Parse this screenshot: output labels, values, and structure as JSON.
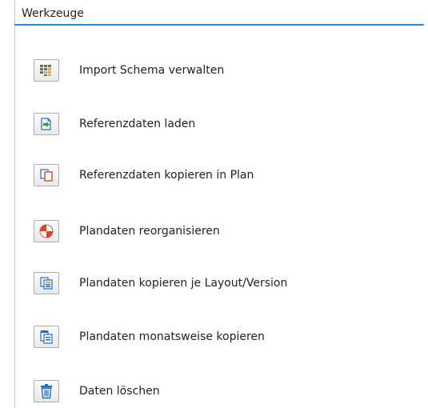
{
  "panel": {
    "title": "Werkzeuge"
  },
  "tools": [
    {
      "label": "Import Schema verwalten",
      "icon": "import-schema-icon"
    },
    {
      "label": "Referenzdaten laden",
      "icon": "load-reference-icon"
    },
    {
      "label": "Referenzdaten kopieren in Plan",
      "icon": "copy-reference-icon"
    },
    {
      "label": "Plandaten reorganisieren",
      "icon": "reorganize-icon"
    },
    {
      "label": "Plandaten kopieren je Layout/Version",
      "icon": "copy-layout-icon"
    },
    {
      "label": "Plandaten monatsweise kopieren",
      "icon": "copy-monthly-icon"
    },
    {
      "label": "Daten löschen",
      "icon": "trash-icon"
    }
  ],
  "colors": {
    "accent": "#2a8ad4",
    "icon_red": "#e0452b",
    "icon_green": "#2e9e48",
    "icon_blue": "#1f6fc1",
    "icon_orange": "#f0a030"
  }
}
